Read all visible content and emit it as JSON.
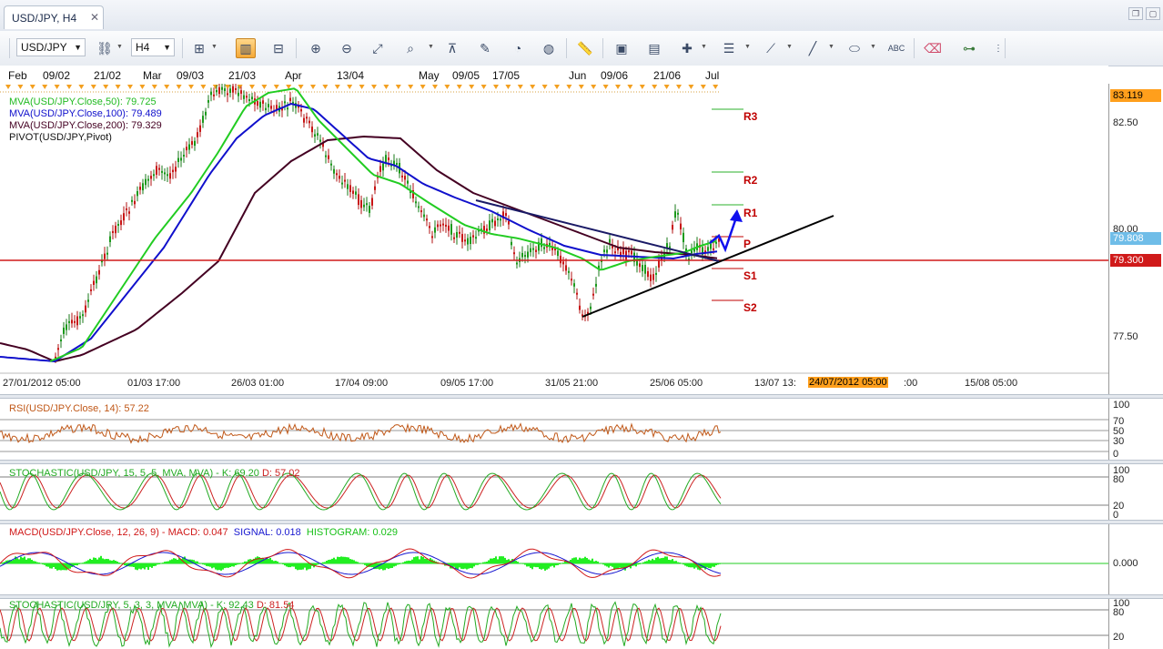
{
  "window": {
    "tab_title": "USD/JPY, H4",
    "close_glyph": "✕"
  },
  "toolbar": {
    "symbol": "USD/JPY",
    "timeframe": "H4",
    "icons": [
      "chain-link-icon",
      "bar-chart-icon",
      "candlestick-icon",
      "line-chart-icon",
      "zoom-in-icon",
      "zoom-out-icon",
      "zoom-fit-icon",
      "zoom-area-icon",
      "scroll-to-end-icon",
      "chart-properties-icon",
      "indicators-icon",
      "globe-icon",
      "ruler-icon",
      "save-image-icon",
      "template-icon",
      "crosshair-icon",
      "horizontal-lines-icon",
      "trendline-tools-icon",
      "pen-icon",
      "ellipse-icon",
      "text-icon",
      "eraser-icon",
      "object-tree-icon",
      "more-icon"
    ]
  },
  "date_bar": [
    "Feb",
    "09/02",
    "21/02",
    "Mar",
    "09/03",
    "21/03",
    "Apr",
    "13/04",
    "May",
    "09/05",
    "17/05",
    "Jun",
    "09/06",
    "21/06",
    "Jul"
  ],
  "main_chart": {
    "legend": [
      {
        "text": "MVA(USD/JPY.Close,50): 79.725",
        "color": "#22bb22"
      },
      {
        "text": "MVA(USD/JPY.Close,100): 79.489",
        "color": "#1010cc"
      },
      {
        "text": "MVA(USD/JPY.Close,200): 79.329",
        "color": "#440022"
      },
      {
        "text": "PIVOT(USD/JPY,Pivot)",
        "color": "#111111"
      }
    ],
    "y_ticks": [
      "82.50",
      "80.00",
      "77.50"
    ],
    "price_tags": [
      {
        "text": "83.119",
        "bg": "#ff9f1c",
        "color": "#000000"
      },
      {
        "text": "79.808",
        "bg": "#6fbde8",
        "color": "#ffffff"
      },
      {
        "text": "79.300",
        "bg": "#d01a1a",
        "color": "#ffffff"
      }
    ],
    "pivot_labels": [
      "R3",
      "R2",
      "R1",
      "P",
      "S1",
      "S2"
    ],
    "time_labels": [
      "27/01/2012 05:00",
      "01/03 17:00",
      "26/03 01:00",
      "17/04 09:00",
      "09/05 17:00",
      "31/05 21:00",
      "25/06 05:00",
      "13/07 13:",
      "24/07/2012 05:00",
      ":00",
      "15/08 05:00"
    ],
    "highlight_time": "24/07/2012 05:00"
  },
  "rsi_panel": {
    "label": "RSI(USD/JPY.Close, 14): 57.22",
    "color": "#c05818",
    "ticks": [
      "100",
      "70",
      "50",
      "30",
      "0"
    ]
  },
  "stoch1_panel": {
    "label_prefix": "STOCHASTIC(USD/JPY, 15, 5, 5, MVA, MVA) - ",
    "k": "K: 69.20",
    "d": "D: 57.02",
    "ticks": [
      "100",
      "80",
      "20",
      "0"
    ]
  },
  "macd_panel": {
    "macd": "MACD(USD/JPY.Close, 12, 26, 9) - MACD: 0.047",
    "signal": "SIGNAL: 0.018",
    "histogram": "HISTOGRAM: 0.029",
    "ticks": [
      "0.000"
    ]
  },
  "stoch2_panel": {
    "label_prefix": "STOCHASTIC(USD/JPY, 5, 3, 3, MVA, MVA) - ",
    "k": "K: 92.43",
    "d": "D: 81.54",
    "ticks": [
      "100",
      "80",
      "20"
    ]
  }
}
